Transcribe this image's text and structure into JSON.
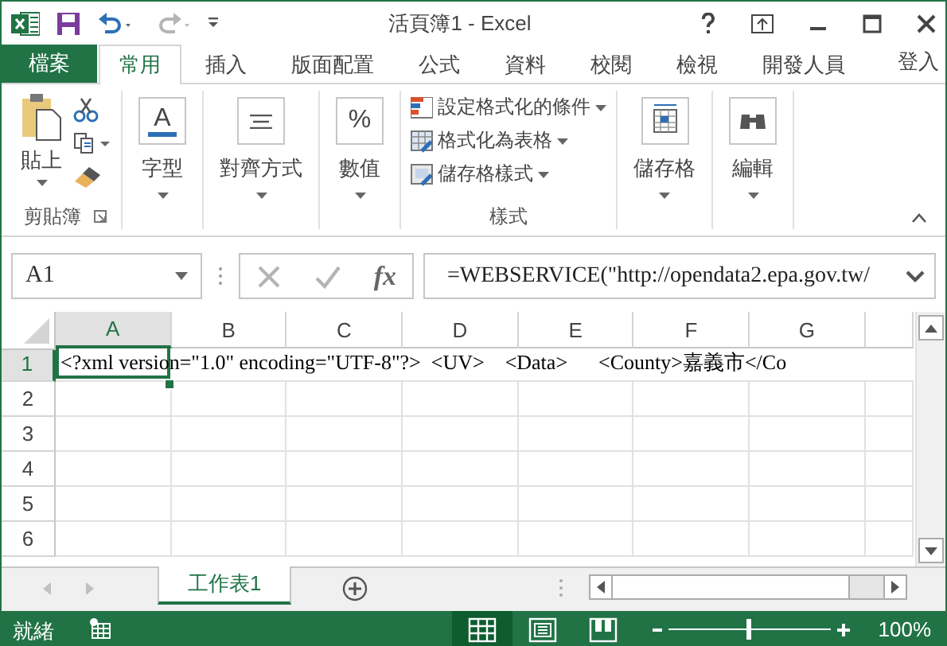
{
  "window": {
    "title": "活頁簿1 - Excel"
  },
  "quick_access": [
    {
      "kind": "save",
      "disabled": false
    },
    {
      "kind": "undo",
      "disabled": false
    },
    {
      "kind": "redo",
      "disabled": true
    },
    {
      "kind": "customize",
      "disabled": false
    }
  ],
  "tabs": [
    {
      "label": "檔案",
      "kind": "file",
      "selected": false
    },
    {
      "label": "常用",
      "kind": "tab",
      "selected": true
    },
    {
      "label": "插入",
      "kind": "tab",
      "selected": false
    },
    {
      "label": "版面配置",
      "kind": "tab",
      "selected": false
    },
    {
      "label": "公式",
      "kind": "tab",
      "selected": false
    },
    {
      "label": "資料",
      "kind": "tab",
      "selected": false
    },
    {
      "label": "校閱",
      "kind": "tab",
      "selected": false
    },
    {
      "label": "檢視",
      "kind": "tab",
      "selected": false
    },
    {
      "label": "開發人員",
      "kind": "tab",
      "selected": false
    }
  ],
  "account": "登入",
  "ribbon": {
    "groups": [
      {
        "kind": "clipboard",
        "title": "剪貼簿",
        "paste": "貼上"
      },
      {
        "kind": "collapsed",
        "label": "字型",
        "glyph": "A"
      },
      {
        "kind": "collapsed",
        "label": "對齊方式"
      },
      {
        "kind": "collapsed",
        "label": "數值",
        "glyph": "%"
      },
      {
        "kind": "styles",
        "title": "樣式",
        "items": [
          "設定格式化的條件",
          "格式化為表格",
          "儲存格樣式"
        ]
      },
      {
        "kind": "collapsed",
        "label": "儲存格"
      },
      {
        "kind": "collapsed",
        "label": "編輯"
      }
    ]
  },
  "formula_bar": {
    "name_box": "A1",
    "fx": "fx",
    "formula": "=WEBSERVICE(\"http://opendata2.epa.gov.tw/"
  },
  "grid": {
    "columns": [
      {
        "label": "A",
        "selected": true
      },
      {
        "label": "B",
        "selected": false
      },
      {
        "label": "C",
        "selected": false
      },
      {
        "label": "D",
        "selected": false
      },
      {
        "label": "E",
        "selected": false
      },
      {
        "label": "F",
        "selected": false
      },
      {
        "label": "G",
        "selected": false
      }
    ],
    "rows": [
      {
        "label": "1",
        "selected": true,
        "text": "<?xml version=\"1.0\" encoding=\"UTF-8\"?>  <UV>    <Data>      <County>嘉義市</Co"
      },
      {
        "label": "2",
        "selected": false
      },
      {
        "label": "3",
        "selected": false
      },
      {
        "label": "4",
        "selected": false
      },
      {
        "label": "5",
        "selected": false
      },
      {
        "label": "6",
        "selected": false
      }
    ]
  },
  "sheet_tabs": [
    {
      "label": "工作表1",
      "selected": true
    }
  ],
  "status_bar": {
    "text": "就緒",
    "views": [
      {
        "kind": "normal",
        "selected": true
      },
      {
        "kind": "page_layout",
        "selected": false
      },
      {
        "kind": "page_break",
        "selected": false
      }
    ],
    "zoom": {
      "level": 0.5,
      "reading": "100%"
    }
  }
}
